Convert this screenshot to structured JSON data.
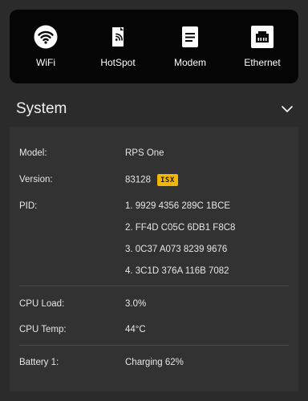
{
  "nav": {
    "items": [
      {
        "label": "WiFi",
        "icon": "wifi-icon"
      },
      {
        "label": "HotSpot",
        "icon": "hotspot-icon"
      },
      {
        "label": "Modem",
        "icon": "modem-icon"
      },
      {
        "label": "Ethernet",
        "icon": "ethernet-icon"
      }
    ]
  },
  "system": {
    "title": "System",
    "model_label": "Model:",
    "model_value": "RPS One",
    "version_label": "Version:",
    "version_value": "83128",
    "version_badge": "ISX",
    "pid_label": "PID:",
    "pids": [
      "1. 9929 4356 289C 1BCE",
      "2. FF4D C05C 6DB1 F8C8",
      "3. 0C37 A073 8239 9676",
      "4. 3C1D 376A 116B 7082"
    ],
    "cpu_load_label": "CPU Load:",
    "cpu_load_value": "3.0%",
    "cpu_temp_label": "CPU Temp:",
    "cpu_temp_value": "44°C",
    "battery_label": "Battery 1:",
    "battery_value": "Charging 62%"
  },
  "colors": {
    "background": "#2b2b2b",
    "top_bar": "#050505",
    "card": "#323232",
    "badge": "#f2b705"
  }
}
